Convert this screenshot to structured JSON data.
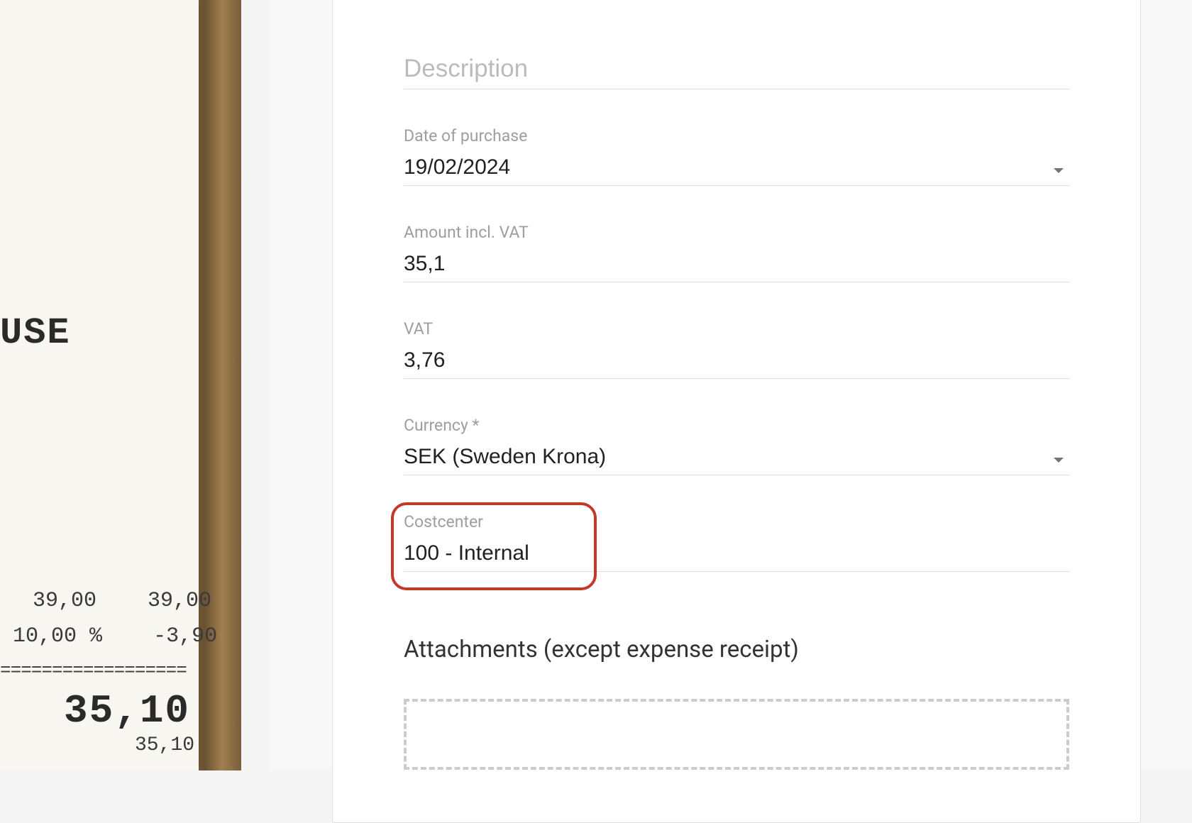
{
  "receipt": {
    "partial_text": "USE",
    "line_items": [
      {
        "col1": "39,00",
        "col2": "39,00"
      },
      {
        "col1": "10,00 %",
        "col2": "-3,90"
      }
    ],
    "total": "35,10",
    "subtotal": "35,10"
  },
  "form": {
    "description_placeholder": "Description",
    "date_label": "Date of purchase",
    "date_value": "19/02/2024",
    "amount_label": "Amount incl. VAT",
    "amount_value": "35,1",
    "vat_label": "VAT",
    "vat_value": "3,76",
    "currency_label": "Currency *",
    "currency_value": "SEK (Sweden Krona)",
    "costcenter_label": "Costcenter",
    "costcenter_value": "100 - Internal",
    "attachments_heading": "Attachments (except expense receipt)"
  }
}
